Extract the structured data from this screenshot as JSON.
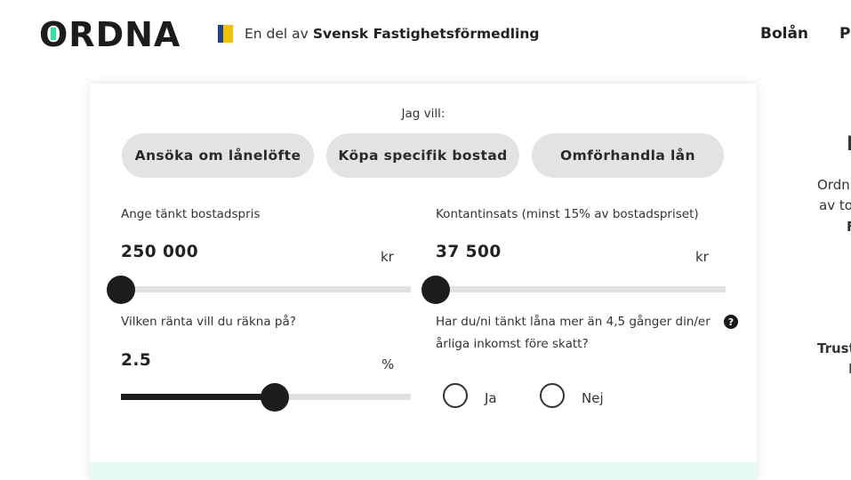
{
  "header": {
    "logo_text": "ORDNA",
    "partner_prefix": "En del av",
    "partner_name": "Svensk Fastighetsförmedling",
    "nav": [
      "Bolån",
      "Pr"
    ]
  },
  "form": {
    "intent_label": "Jag vill:",
    "intent_options": [
      "Ansöka om lånelöfte",
      "Köpa specifik bostad",
      "Omförhandla lån"
    ],
    "price": {
      "label": "Ange tänkt bostadspris",
      "value": "250 000",
      "unit": "kr",
      "slider_fraction": 0.0
    },
    "deposit": {
      "label": "Kontantinsats (minst 15% av bostadspriset)",
      "value": "37 500",
      "unit": "kr",
      "slider_fraction": 0.0
    },
    "rate": {
      "label": "Vilken ränta vill du räkna på?",
      "value": "2.5",
      "unit": "%",
      "slider_fraction": 0.53
    },
    "income_question": {
      "line1": "Har du/ni tänkt låna mer än 4,5 gånger din/er",
      "line2": "årliga inkomst före skatt?",
      "help_icon": "?",
      "options": [
        "Ja",
        "Nej"
      ]
    }
  },
  "right_column": {
    "heading_fragment": "I",
    "line1": "Ordn",
    "line2": "av to",
    "line3": "F",
    "trust_fragment": "Trust",
    "trust_line2": "I"
  },
  "colors": {
    "pill_bg": "#e3e3e3",
    "slider_dark": "#1c1c1c",
    "slider_track": "#e0e0e0",
    "accent_green": "#2ee59d",
    "flag_blue": "#1f3f8f",
    "flag_yellow": "#f2c200"
  }
}
